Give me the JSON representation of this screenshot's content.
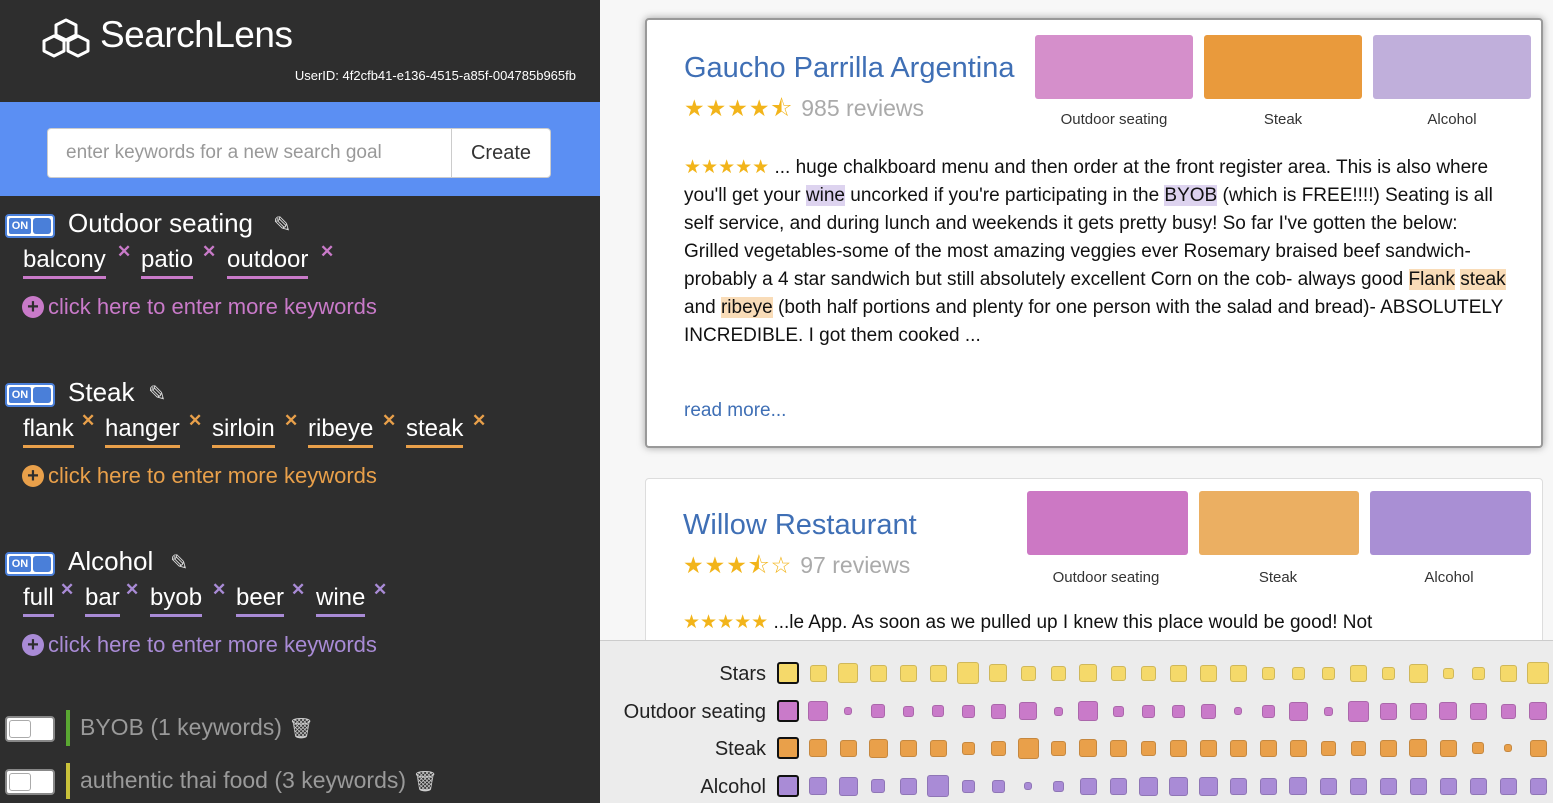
{
  "app": {
    "title": "SearchLens",
    "user_id": "UserID: 4f2cfb41-e136-4515-a85f-004785b965fb"
  },
  "goal_bar": {
    "placeholder": "enter keywords for a new search goal",
    "create_label": "Create"
  },
  "colors": {
    "sidebar_bg": "#2e2e2e",
    "goal_bar_bg": "#5b8ff3",
    "outdoor": "#c97ac9",
    "steak": "#e9a04a",
    "alcohol": "#a98bd6",
    "stars": "#f5d96a",
    "link": "#3f6fb5"
  },
  "goals": [
    {
      "toggle": "ON",
      "name": "Outdoor seating",
      "keywords": [
        "balcony",
        "patio",
        "outdoor"
      ],
      "add_more": "click here to enter more keywords"
    },
    {
      "toggle": "ON",
      "name": "Steak",
      "keywords": [
        "flank",
        "hanger",
        "sirloin",
        "ribeye",
        "steak"
      ],
      "add_more": "click here to enter more keywords"
    },
    {
      "toggle": "ON",
      "name": "Alcohol",
      "keywords": [
        "full",
        "bar",
        "byob",
        "beer",
        "wine"
      ],
      "add_more": "click here to enter more keywords"
    }
  ],
  "inactive_goals": [
    {
      "name": "BYOB",
      "count": "(1 keywords)"
    },
    {
      "name": "authentic thai food",
      "count": "(3 keywords)"
    }
  ],
  "results": [
    {
      "name": "Gaucho Parrilla Argentina",
      "rating_stars": "★★★★⯪",
      "rating": 4.5,
      "reviews": "985 reviews",
      "swatch_labels": [
        "Outdoor seating",
        "Steak",
        "Alcohol"
      ],
      "review_stars": "★★★★★",
      "review_parts": [
        {
          "t": " ... huge chalkboard menu and then order at the front register area. This is also where you'll get your "
        },
        {
          "t": "wine",
          "hl": "purple"
        },
        {
          "t": " uncorked if you're participating in the "
        },
        {
          "t": "BYOB",
          "hl": "purple"
        },
        {
          "t": " (which is FREE!!!!) Seating is all self service, and during lunch and weekends it gets pretty busy! So far I've gotten the below: Grilled vegetables-some of the most amazing veggies ever Rosemary braised beef sandwich- probably a 4 star sandwich but still absolutely excellent Corn on the cob- always good "
        },
        {
          "t": "Flank",
          "hl": "orange"
        },
        {
          "t": " "
        },
        {
          "t": "steak",
          "hl": "orange"
        },
        {
          "t": " and "
        },
        {
          "t": "ribeye",
          "hl": "orange"
        },
        {
          "t": " (both half portions and plenty for one person with the salad and bread)- ABSOLUTELY INCREDIBLE. I got them cooked ..."
        }
      ],
      "read_more": "read more..."
    },
    {
      "name": "Willow Restaurant",
      "rating_stars": "★★★⯪☆",
      "rating": 3.5,
      "reviews": "97 reviews",
      "swatch_labels": [
        "Outdoor seating",
        "Steak",
        "Alcohol"
      ],
      "review_stars": "★★★★★",
      "review_text": " ...le App. As soon as we pulled up I knew this place would be good! Not"
    }
  ],
  "overview": {
    "rows": [
      "Stars",
      "Outdoor seating",
      "Steak",
      "Alcohol"
    ],
    "levels": [
      [
        1.0,
        0.75,
        0.9,
        0.75,
        0.75,
        0.75,
        1.0,
        0.8,
        0.7,
        0.7,
        0.8,
        0.7,
        0.7,
        0.75,
        0.75,
        0.75,
        0.6,
        0.6,
        0.6,
        0.75,
        0.6,
        0.85,
        0.5,
        0.6,
        0.75,
        1.0
      ],
      [
        1.0,
        0.9,
        0.35,
        0.65,
        0.5,
        0.55,
        0.6,
        0.7,
        0.8,
        0.4,
        0.9,
        0.5,
        0.6,
        0.6,
        0.7,
        0.35,
        0.6,
        0.85,
        0.4,
        0.95,
        0.75,
        0.75,
        0.8,
        0.75,
        0.7,
        0.8
      ],
      [
        1.0,
        0.8,
        0.75,
        0.85,
        0.75,
        0.75,
        0.6,
        0.7,
        0.95,
        0.7,
        0.8,
        0.75,
        0.7,
        0.75,
        0.75,
        0.75,
        0.75,
        0.75,
        0.7,
        0.7,
        0.75,
        0.8,
        0.75,
        0.55,
        0.35,
        0.75
      ],
      [
        1.0,
        0.8,
        0.85,
        0.65,
        0.75,
        1.0,
        0.6,
        0.6,
        0.35,
        0.5,
        0.75,
        0.75,
        0.85,
        0.85,
        0.85,
        0.75,
        0.75,
        0.8,
        0.75,
        0.75,
        0.75,
        0.75,
        0.75,
        0.75,
        0.75,
        0.75
      ]
    ]
  }
}
